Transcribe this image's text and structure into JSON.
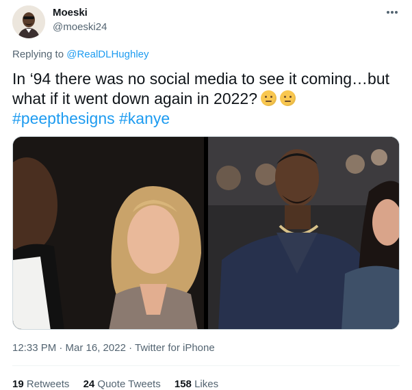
{
  "author": {
    "name": "Moeski",
    "handle": "@moeski24"
  },
  "reply": {
    "prefix": "Replying to",
    "target": "@RealDLHughley"
  },
  "tweet": {
    "line1": "In ‘94 there was no social media to see it coming…but",
    "line2": "what if it went down again in 2022?",
    "emoji": "thinking-face",
    "hashtag1": "#peepthesigns",
    "hashtag2": "#kanye"
  },
  "media": {
    "left": "photo-couple-1994",
    "right": "photo-couple-event"
  },
  "meta": {
    "text": "12:33 PM · Mar 16, 2022 · Twitter for iPhone"
  },
  "stats": {
    "retweets_count": "19",
    "retweets_label": "Retweets",
    "quotes_count": "24",
    "quotes_label": "Quote Tweets",
    "likes_count": "158",
    "likes_label": "Likes"
  },
  "colors": {
    "link": "#1d9bf0",
    "secondary": "#536471",
    "text": "#0f1419"
  }
}
